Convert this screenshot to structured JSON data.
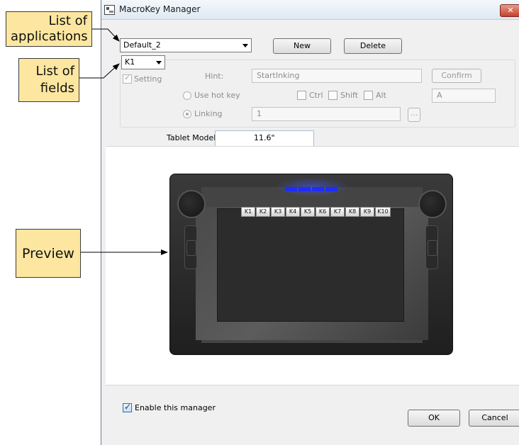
{
  "callouts": {
    "applications": "List of applications",
    "applications_l1": "List of",
    "applications_l2": "applications",
    "fields_l1": "List of",
    "fields_l2": "fields",
    "preview": "Preview"
  },
  "window": {
    "title": "MacroKey Manager",
    "close_glyph": "✕"
  },
  "top": {
    "application_select": "Default_2",
    "new_label": "New",
    "delete_label": "Delete",
    "field_select": "K1"
  },
  "settings": {
    "setting_label": "Setting",
    "hint_label": "Hint:",
    "hint_value": "StartInking",
    "confirm_label": "Confirm",
    "use_hot_key_label": "Use hot key",
    "ctrl_label": "Ctrl",
    "shift_label": "Shift",
    "alt_label": "Alt",
    "hot_key_value": "A",
    "linking_label": "Linking",
    "linking_value": "1",
    "browse_label": "..."
  },
  "tablet": {
    "model_label": "Tablet Model:",
    "model_value": "11.6\"",
    "hot_keys": [
      "K1",
      "K2",
      "K3",
      "K4",
      "K5",
      "K6",
      "K7",
      "K8",
      "K9",
      "K10"
    ]
  },
  "bottom": {
    "enable_label": "Enable this manager",
    "ok_label": "OK",
    "cancel_label": "Cancel"
  },
  "colors": {
    "callout_bg": "#fde7a0",
    "led_blue": "#1e2cff",
    "window_bg": "#f0f0f0"
  }
}
